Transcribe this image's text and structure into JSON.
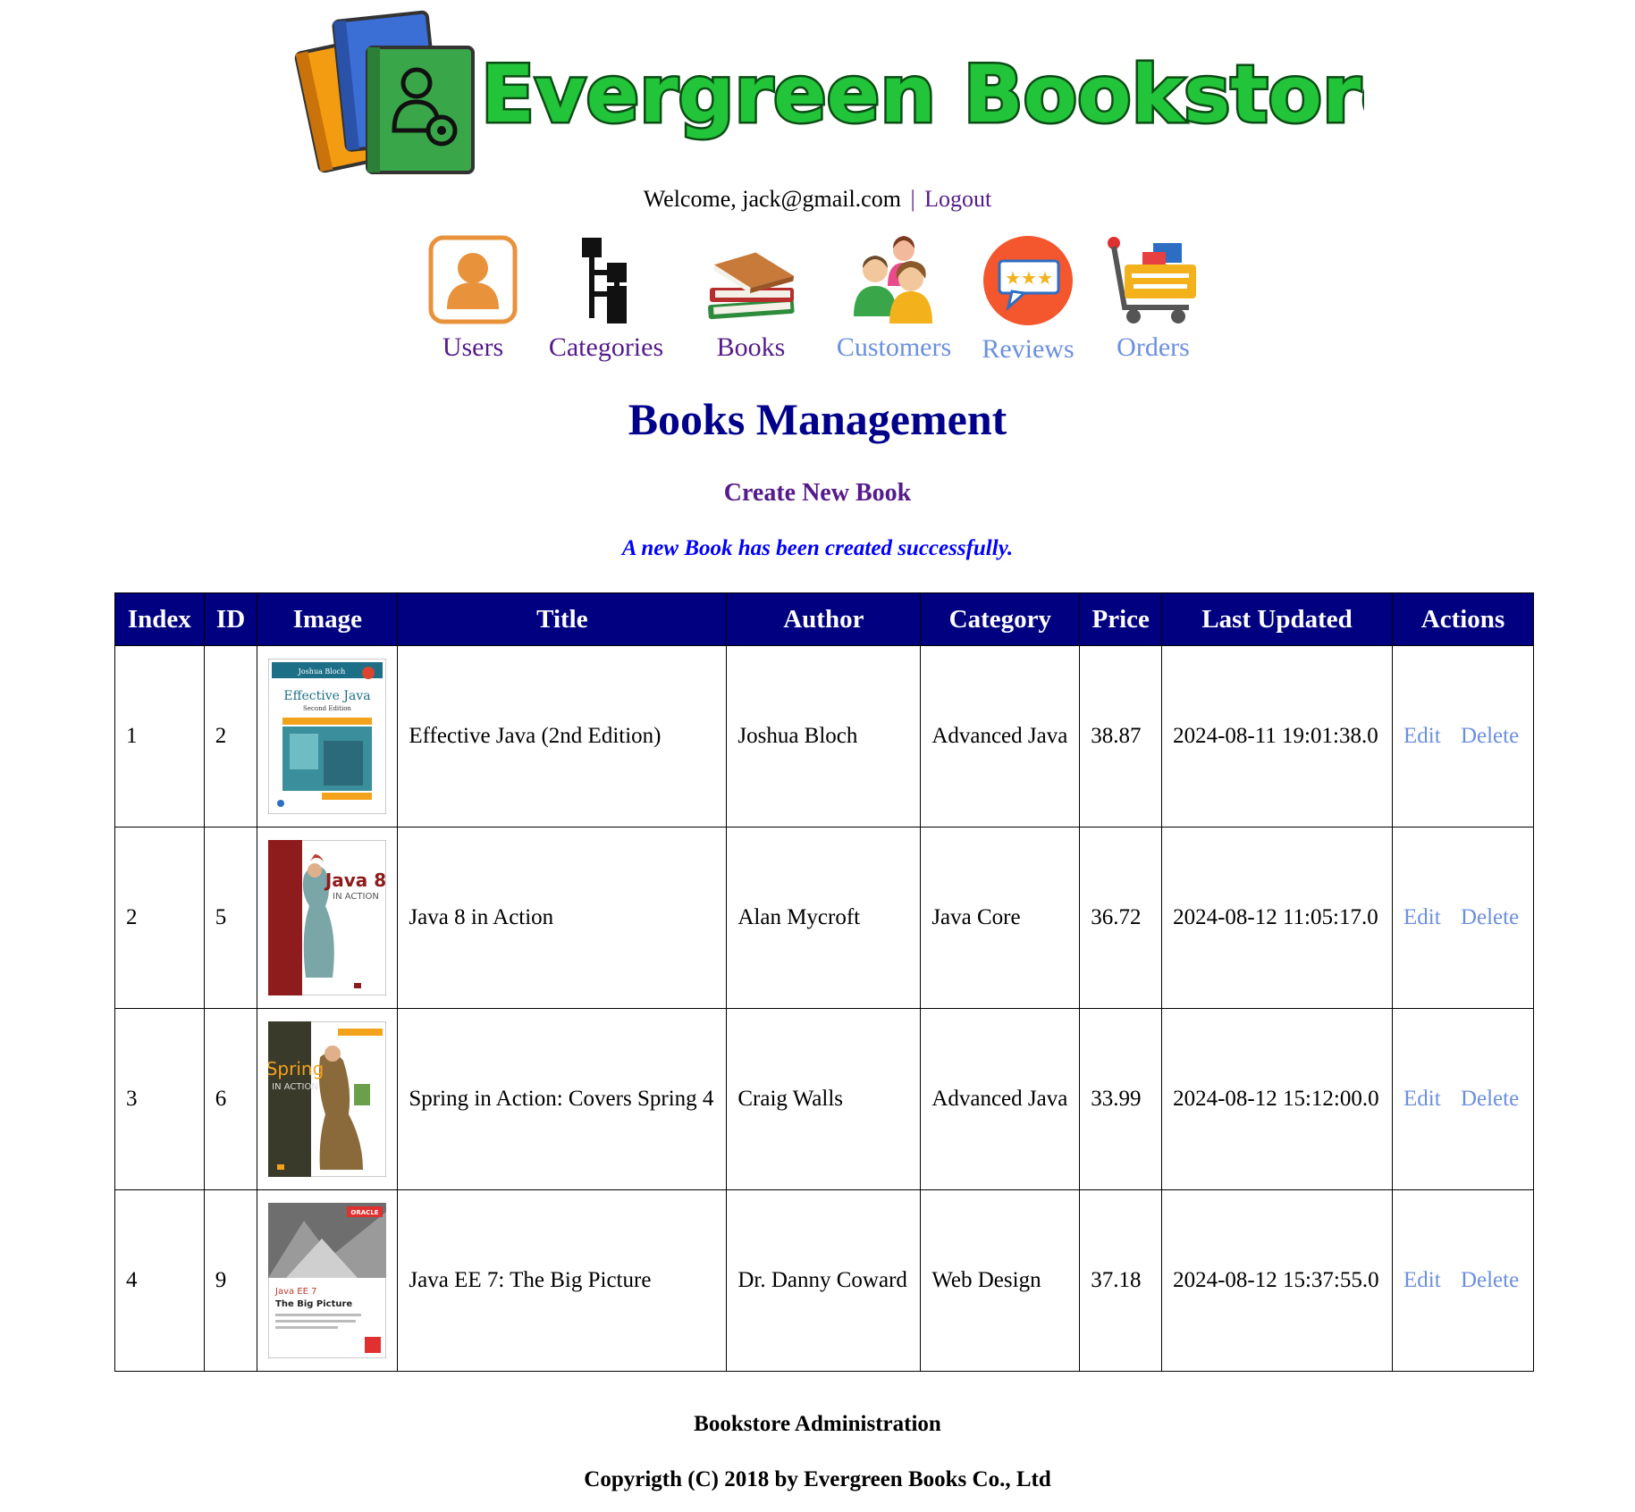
{
  "header": {
    "logo_text": "Evergreen Bookstore",
    "welcome_text": "Welcome, jack@gmail.com",
    "separator": "|",
    "logout_label": "Logout"
  },
  "nav": {
    "users": "Users",
    "categories": "Categories",
    "books": "Books",
    "customers": "Customers",
    "reviews": "Reviews",
    "orders": "Orders"
  },
  "main": {
    "title": "Books Management",
    "create_link": "Create New Book",
    "message": "A new Book has been created successfully."
  },
  "table": {
    "headers": {
      "index": "Index",
      "id": "ID",
      "image": "Image",
      "title": "Title",
      "author": "Author",
      "category": "Category",
      "price": "Price",
      "last_updated": "Last Updated",
      "actions": "Actions"
    },
    "rows": [
      {
        "index": "1",
        "id": "2",
        "title": "Effective Java (2nd Edition)",
        "author": "Joshua Bloch",
        "category": "Advanced Java",
        "price": "38.87",
        "last_updated": "2024-08-11 19:01:38.0",
        "edit": "Edit",
        "delete": "Delete",
        "cover": {
          "author_line": "Joshua Bloch",
          "title_line": "Effective Java",
          "subtitle_line": "Second Edition"
        }
      },
      {
        "index": "2",
        "id": "5",
        "title": "Java 8 in Action",
        "author": "Alan Mycroft",
        "category": "Java Core",
        "price": "36.72",
        "last_updated": "2024-08-12 11:05:17.0",
        "edit": "Edit",
        "delete": "Delete",
        "cover": {
          "title_line": "Java 8",
          "subtitle_line": "IN ACTION"
        }
      },
      {
        "index": "3",
        "id": "6",
        "title": "Spring in Action: Covers Spring 4",
        "author": "Craig Walls",
        "category": "Advanced Java",
        "price": "33.99",
        "last_updated": "2024-08-12 15:12:00.0",
        "edit": "Edit",
        "delete": "Delete",
        "cover": {
          "title_line": "Spring",
          "subtitle_line": "IN ACTION"
        }
      },
      {
        "index": "4",
        "id": "9",
        "title": "Java EE 7: The Big Picture",
        "author": "Dr. Danny Coward",
        "category": "Web Design",
        "price": "37.18",
        "last_updated": "2024-08-12 15:37:55.0",
        "edit": "Edit",
        "delete": "Delete",
        "cover": {
          "brand_line": "ORACLE",
          "title_line": "Java EE 7",
          "subtitle_line": "The Big Picture"
        }
      }
    ]
  },
  "footer": {
    "line1": "Bookstore Administration",
    "line2": "Copyrigth (C) 2018 by Evergreen Books Co., Ltd"
  },
  "colors": {
    "header_bg": "#000080",
    "title": "#00008b",
    "visited_link": "#551a8b",
    "unvisited_link": "#6b8fe0",
    "message": "#0000ff",
    "logo_green": "#22c43a"
  },
  "icons": {
    "users": "user-avatar-icon",
    "categories": "hierarchy-tree-icon",
    "books": "book-stack-icon",
    "customers": "people-group-icon",
    "reviews": "rating-speech-bubble-icon",
    "orders": "shopping-cart-icon"
  }
}
